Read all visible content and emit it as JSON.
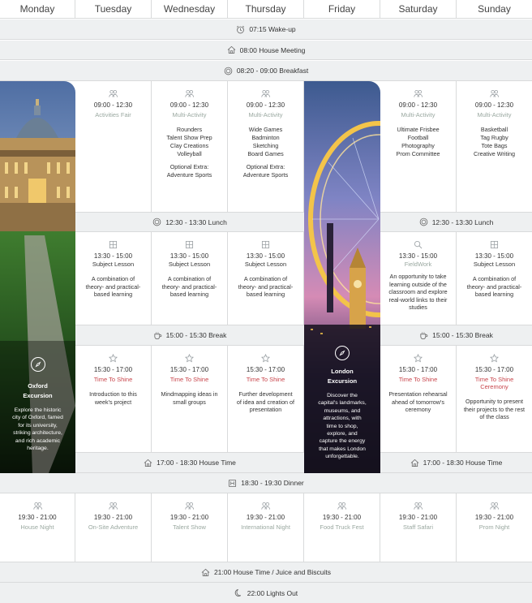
{
  "days": [
    "Monday",
    "Tuesday",
    "Wednesday",
    "Thursday",
    "Friday",
    "Saturday",
    "Sunday"
  ],
  "bands": {
    "wake": "07:15  Wake-up",
    "meeting": "08:00  House Meeting",
    "breakfast": "08:20 - 09:00  Breakfast",
    "lunch_a": "12:30 - 13:30  Lunch",
    "lunch_b": "12:30 - 13:30  Lunch",
    "break_a": "15:00 - 15:30 Break",
    "break_b": "15:00 - 15:30 Break",
    "housetime_a": "17:00 - 18:30  House Time",
    "housetime_b": "17:00 - 18:30  House Time",
    "dinner": "18:30 - 19:30  Dinner",
    "juice": "21:00 House Time /  Juice and Biscuits",
    "lights": "22:00  Lights Out"
  },
  "morning": {
    "tue": {
      "time": "09:00 - 12:30",
      "title": "Activities Fair"
    },
    "wed": {
      "time": "09:00 - 12:30",
      "title": "Multi-Activity",
      "items": [
        "Rounders",
        "Talent Show Prep",
        "Clay Creations",
        "Volleyball"
      ],
      "extra": "Optional Extra:",
      "extra2": "Adventure Sports"
    },
    "thu": {
      "time": "09:00 - 12:30",
      "title": "Multi-Activity",
      "items": [
        "Wide Games",
        "Badminton",
        "Sketching",
        "Board Games"
      ],
      "extra": "Optional Extra:",
      "extra2": "Adventure Sports"
    },
    "sat": {
      "time": "09:00 - 12:30",
      "title": "Multi-Activity",
      "items": [
        "Ultimate Frisbee",
        "Football",
        "Photography",
        "Prom Committee"
      ]
    },
    "sun": {
      "time": "09:00 - 12:30",
      "title": "Multi-Activity",
      "items": [
        "Basketball",
        "Tag Rugby",
        "Tote Bags",
        "Creative Writing"
      ]
    }
  },
  "afternoon": {
    "tue": {
      "time": "13:30 - 15:00",
      "title": "Subject Lesson",
      "desc": [
        "A combination of",
        "theory- and practical-",
        "based learning"
      ]
    },
    "wed": {
      "time": "13:30 - 15:00",
      "title": "Subject Lesson",
      "desc": [
        "A combination of",
        "theory- and practical-",
        "based learning"
      ]
    },
    "thu": {
      "time": "13:30 - 15:00",
      "title": "Subject Lesson",
      "desc": [
        "A combination of",
        "theory- and practical-",
        "based learning"
      ]
    },
    "sat": {
      "time": "13:30 - 15:00",
      "title": "FieldWork",
      "desc": [
        "An opportunity to take",
        "learning outside of the",
        "classroom and explore",
        "real-world links to their",
        "studies"
      ]
    },
    "sun": {
      "time": "13:30 - 15:00",
      "title": "Subject Lesson",
      "desc": [
        "A combination of",
        "theory- and practical-",
        "based learning"
      ]
    }
  },
  "late": {
    "tue": {
      "time": "15:30 - 17:00",
      "title": "Time To Shine",
      "desc": [
        "Introduction to this",
        "week's project"
      ]
    },
    "wed": {
      "time": "15:30 - 17:00",
      "title": "Time To Shine",
      "desc": [
        "Mindmapping ideas in",
        "small groups"
      ]
    },
    "thu": {
      "time": "15:30 - 17:00",
      "title": "Time To Shine",
      "desc": [
        "Further development",
        "of idea and creation of",
        "presentation"
      ]
    },
    "sat": {
      "time": "15:30 - 17:00",
      "title": "Time To Shine",
      "desc": [
        "Presentation rehearsal",
        "ahead of tomorrow's",
        "ceremony"
      ]
    },
    "sun": {
      "time": "15:30 - 17:00",
      "title": "Time To Shine",
      "title2": "Ceremony",
      "desc": [
        "Opportunity to present",
        "their projects to the rest",
        "of the class"
      ]
    }
  },
  "evening": [
    {
      "time": "19:30 - 21:00",
      "title": "House Night"
    },
    {
      "time": "19:30 - 21:00",
      "title": "On-Site Adventure"
    },
    {
      "time": "19:30 - 21:00",
      "title": "Talent Show"
    },
    {
      "time": "19:30 - 21:00",
      "title": "International Night"
    },
    {
      "time": "19:30 - 21:00",
      "title": "Food Truck Fest"
    },
    {
      "time": "19:30 - 21:00",
      "title": "Staff Safari"
    },
    {
      "time": "19:30 - 21:00",
      "title": "Prom Night"
    }
  ],
  "excursions": {
    "oxford": {
      "title": [
        "Oxford",
        "Excursion"
      ],
      "desc": [
        "Explore the historic",
        "city of Oxford, famed",
        "for its university,",
        "striking architecture,",
        "and rich academic",
        "heritage."
      ]
    },
    "london": {
      "title": [
        "London",
        "Excursion"
      ],
      "desc": [
        "Discover the",
        "capital's landmarks,",
        "museums, and",
        "attractions, with",
        "time to shop,",
        "explore, and",
        "capture the energy",
        "that makes London",
        "unforgettable."
      ]
    }
  },
  "colors": {
    "band_bg": "#eef0f1",
    "grid": "#d9dadb",
    "accent_red": "#c8454b",
    "muted_green": "#9aa8a0"
  }
}
